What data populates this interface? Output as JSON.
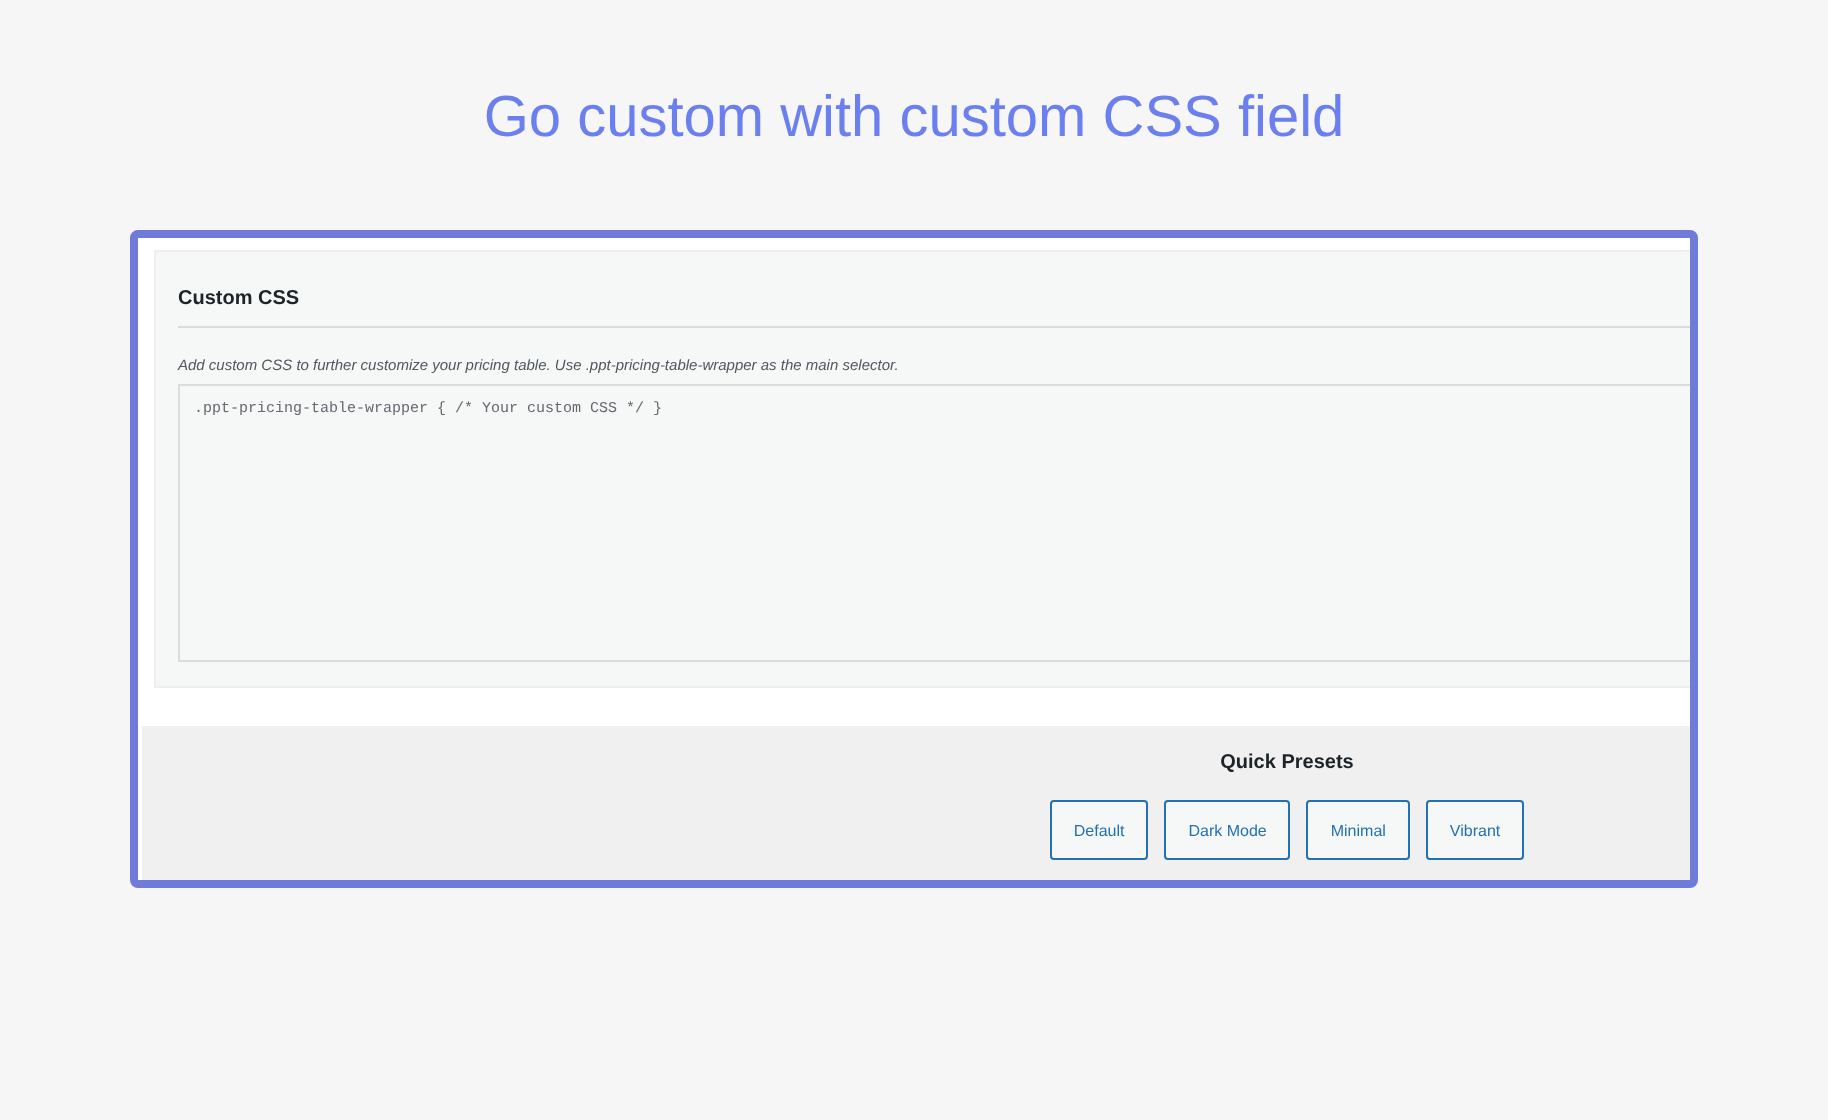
{
  "heading": "Go custom with custom CSS field",
  "custom_css": {
    "title": "Custom CSS",
    "description": "Add custom CSS to further customize your pricing table. Use .ppt-pricing-table-wrapper as the main selector.",
    "value": ".ppt-pricing-table-wrapper { /* Your custom CSS */ }"
  },
  "quick_presets": {
    "title": "Quick Presets",
    "buttons": [
      {
        "label": "Default"
      },
      {
        "label": "Dark Mode"
      },
      {
        "label": "Minimal"
      },
      {
        "label": "Vibrant"
      }
    ]
  }
}
